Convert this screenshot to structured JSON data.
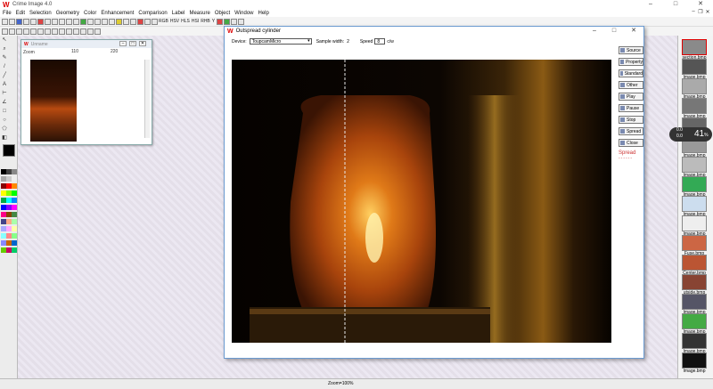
{
  "app": {
    "title": "Crime Image 4.0"
  },
  "menu": [
    "File",
    "Edit",
    "Selection",
    "Geometry",
    "Color",
    "Enhancement",
    "Comparison",
    "Label",
    "Measure",
    "Object",
    "Window",
    "Help"
  ],
  "toolbar_labels": [
    "RGB",
    "HSV",
    "HLS",
    "HSI",
    "RHB",
    "Y"
  ],
  "child_window": {
    "title": "Unname",
    "ruler_ticks": [
      "110",
      "220"
    ],
    "zoom_label": "Zoom"
  },
  "dialog": {
    "title": "Outspread cylinder",
    "device_label": "Device:",
    "device_value": "ToupcamMicro",
    "sample_label": "Sample width:",
    "sample_value": "2",
    "speed_label": "Speed",
    "speed_value": "8",
    "speed_unit": "c/w",
    "buttons": [
      "Source",
      "Property",
      "Standard",
      "Other",
      "Play",
      "Pause",
      "Stop",
      "Spread",
      "Close"
    ],
    "spread_label": "Spread"
  },
  "scale_widget": {
    "value": "41",
    "unit": "%",
    "sub1": "0.0",
    "sub2": "0.0"
  },
  "strip": [
    {
      "label": "section.bmp"
    },
    {
      "label": "Image.bmp"
    },
    {
      "label": "Image.bmp"
    },
    {
      "label": "Image.bmp"
    },
    {
      "label": "Image.bmp"
    },
    {
      "label": "Image.bmp"
    },
    {
      "label": "Image.bmp"
    },
    {
      "label": "Image.bmp"
    },
    {
      "label": "Image.bmp"
    },
    {
      "label": "Image.bmp"
    },
    {
      "label": "Fuse.bmp"
    },
    {
      "label": "Center.bmp"
    },
    {
      "label": "utside.bmp"
    },
    {
      "label": "Image.bmp"
    },
    {
      "label": "Image.bmp"
    },
    {
      "label": "Image.bmp"
    },
    {
      "label": "Image.bmp"
    }
  ],
  "status": {
    "zoom": "Zoom=100%"
  },
  "colors": {
    "accent": "#d00000",
    "dialog_border": "#6a9ad0"
  }
}
